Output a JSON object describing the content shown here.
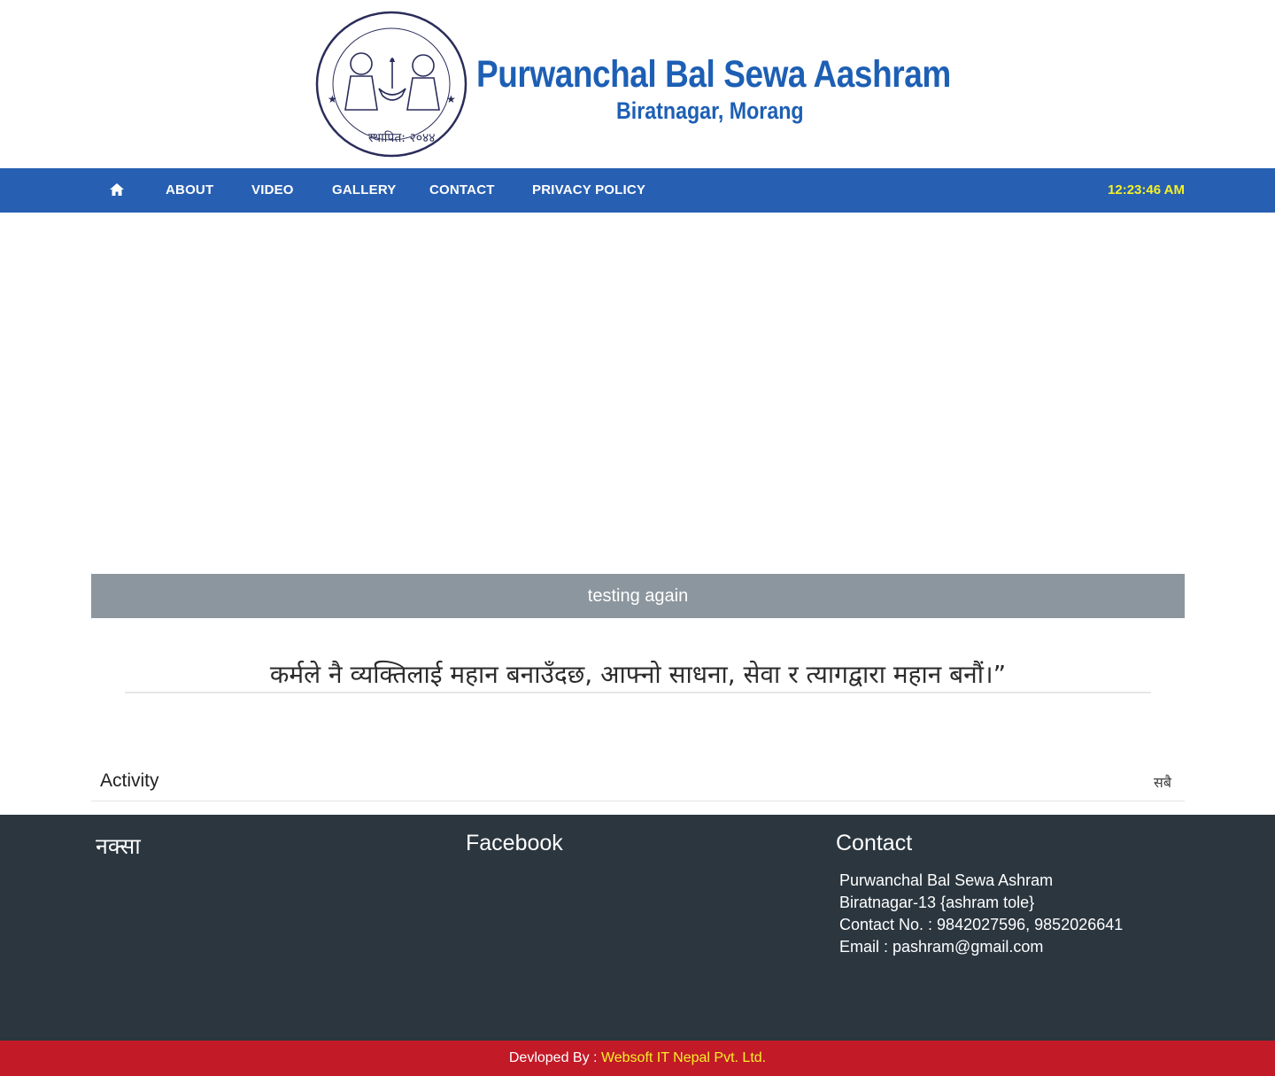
{
  "header": {
    "logo_title": "Purwanchal Bal Sewa Aashram",
    "logo_subtitle": "Biratnagar, Morang",
    "seal_text_top": "पूर्वाञ्चल बाल सेवा आश्रम, विराटनगर",
    "seal_text_bottom": "स्थापित: २०४४"
  },
  "nav": {
    "home_icon": "home-icon",
    "items": [
      "ABOUT",
      "VIDEO",
      "GALLERY",
      "CONTACT",
      "PRIVACY POLICY"
    ],
    "clock": "12:23:46 AM"
  },
  "banner": {
    "text": "testing again"
  },
  "quote": {
    "text": "कर्मले नै व्यक्तिलाई महान बनाउँदछ, आफ्नो साधना, सेवा र त्यागद्वारा महान बनौं।”"
  },
  "activity": {
    "title": "Activity",
    "view_all": "सबै"
  },
  "footer": {
    "map_title": "नक्सा",
    "facebook_title": "Facebook",
    "contact_title": "Contact",
    "contact_lines": [
      "Purwanchal Bal Sewa Ashram",
      "Biratnagar-13 {ashram tole}",
      "Contact No. : 9842027596, 9852026641",
      "Email : pashram@gmail.com"
    ]
  },
  "bottom": {
    "prefix": "Devloped By : ",
    "developer": "Websoft IT Nepal Pvt. Ltd."
  },
  "colors": {
    "nav_bg": "#275fb2",
    "clock": "#f5f126",
    "banner_bg": "#8c969e",
    "footer_bg": "#2b363f",
    "bottom_bar_bg": "#c31a28",
    "brand_blue": "#1d5fb4"
  }
}
